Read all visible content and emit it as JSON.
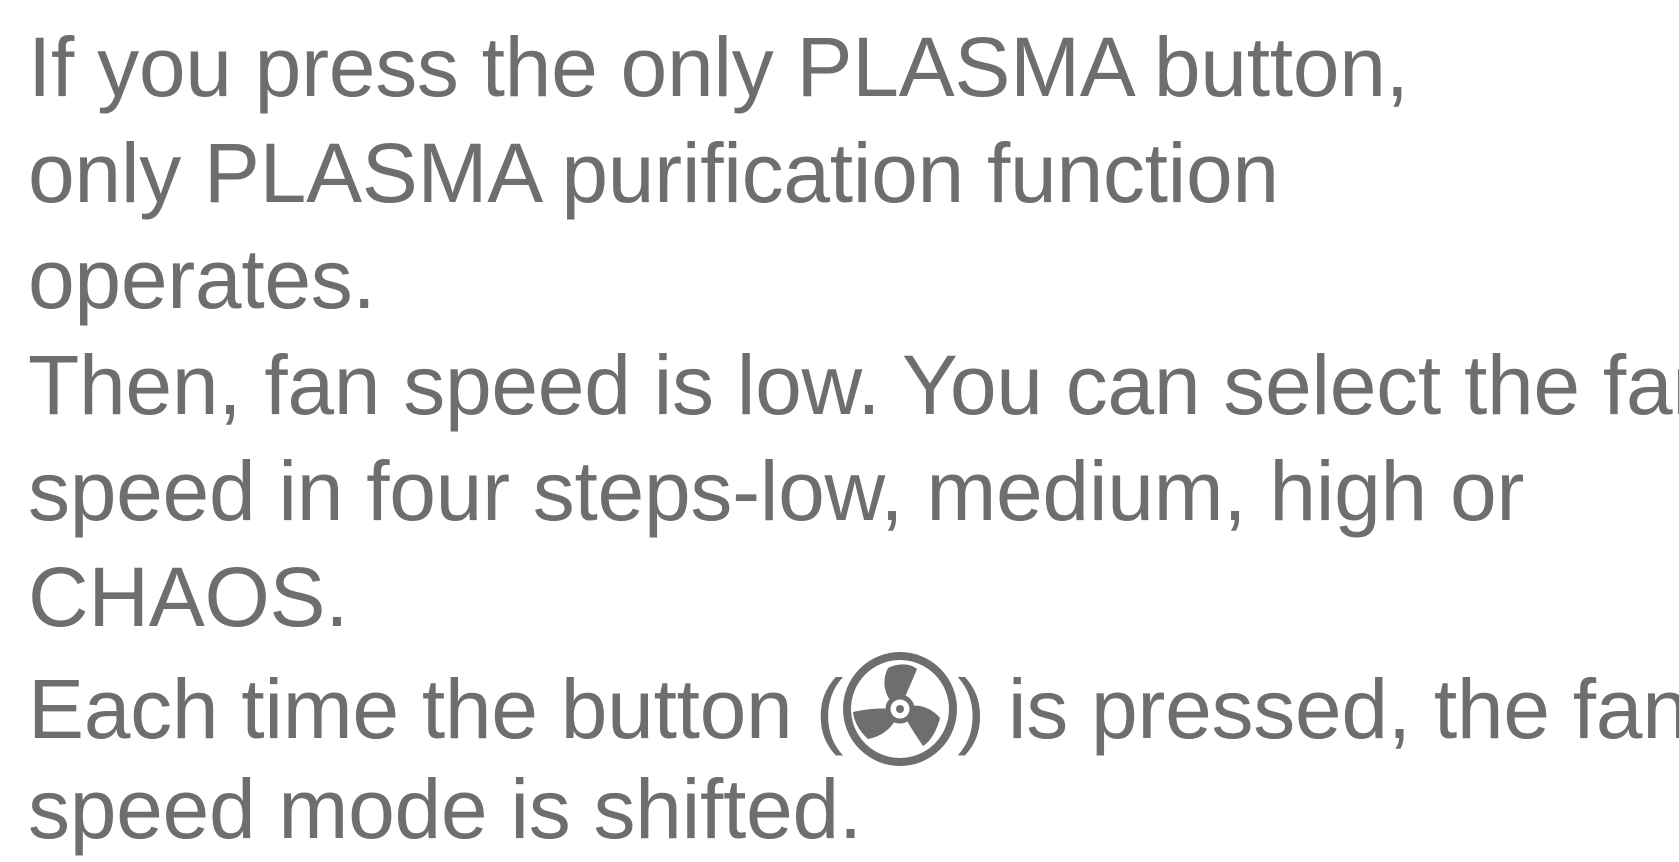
{
  "paragraphs": [
    {
      "lines": [
        "If you press the only PLASMA button,",
        "only PLASMA purification function",
        "operates."
      ]
    },
    {
      "lines": [
        "Then, fan speed is low. You can select the fan",
        "speed in four steps-low, medium, high or",
        "CHAOS."
      ]
    },
    {
      "line1_before_icon": "Each time the button (",
      "icon": "fan-icon",
      "line1_after_icon": ") is pressed, the fan",
      "line2": "speed mode is shifted."
    }
  ],
  "colors": {
    "text": "#6e6e6e",
    "icon": "#6e6e6e",
    "background": "#ffffff"
  }
}
